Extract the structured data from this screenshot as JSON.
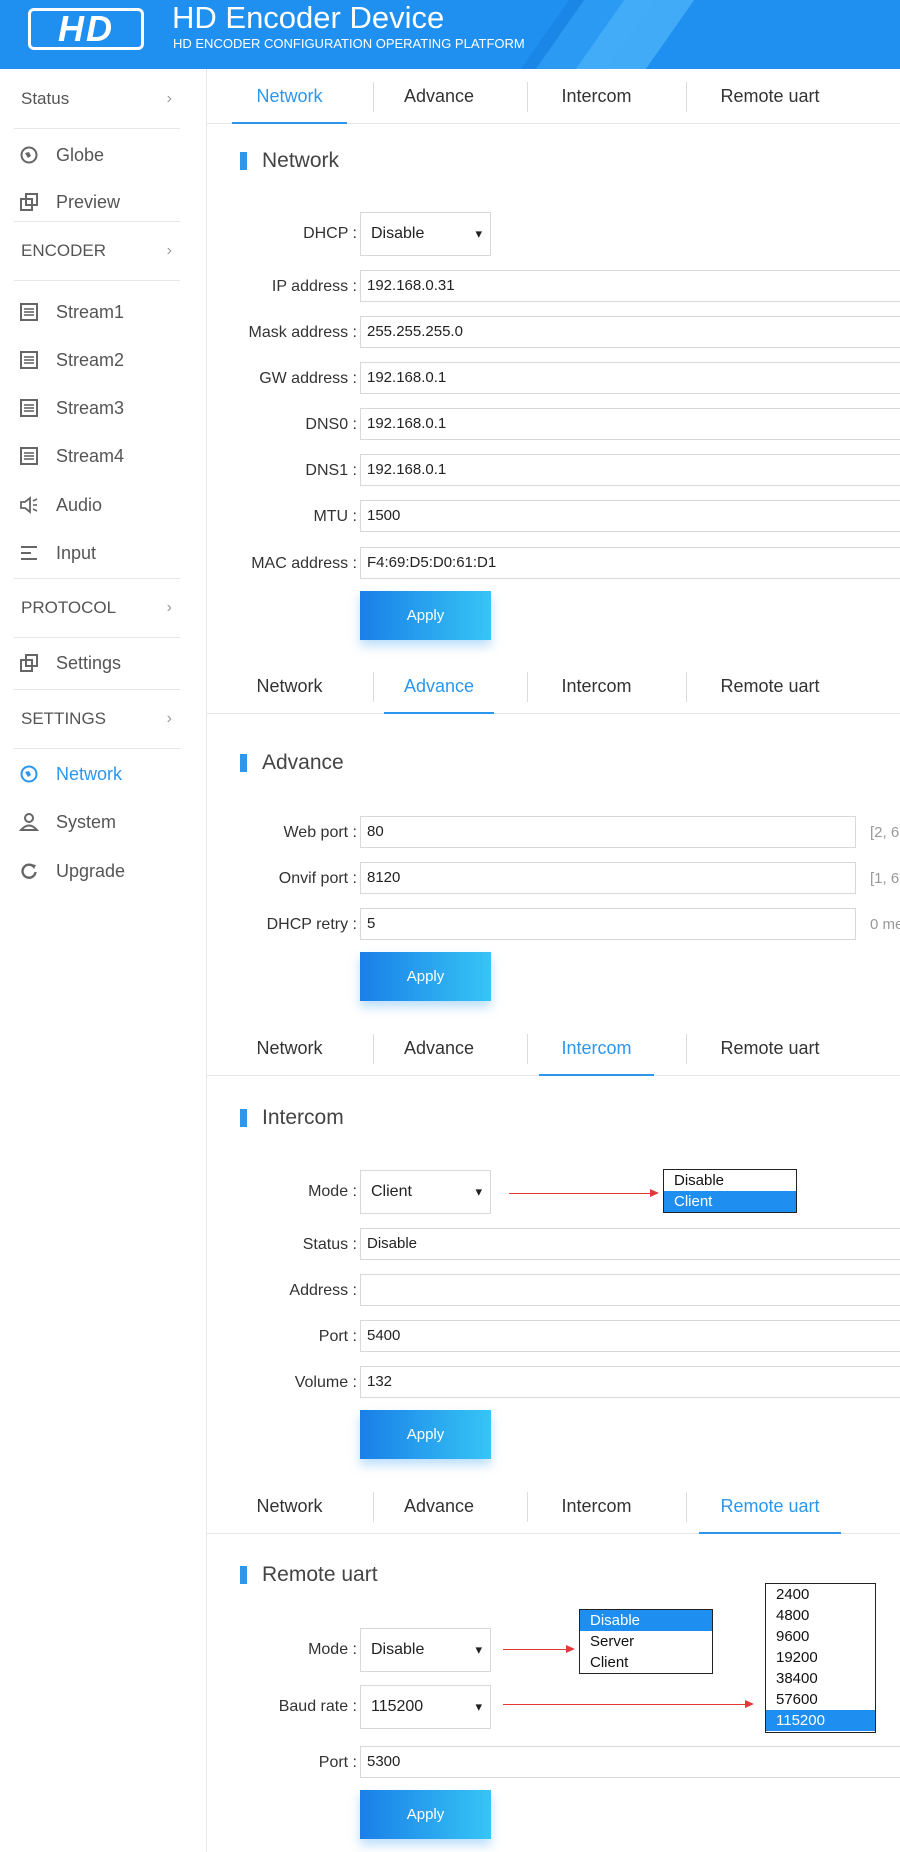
{
  "header": {
    "logo": "HD",
    "title": "HD Encoder Device",
    "subtitle": "HD ENCODER CONFIGURATION OPERATING PLATFORM"
  },
  "sidebar": {
    "groups": {
      "status": "Status",
      "encoder": "ENCODER",
      "protocol": "PROTOCOL",
      "settings": "SETTINGS"
    },
    "items": {
      "globe": "Globe",
      "preview": "Preview",
      "stream1": "Stream1",
      "stream2": "Stream2",
      "stream3": "Stream3",
      "stream4": "Stream4",
      "audio": "Audio",
      "input": "Input",
      "settings": "Settings",
      "network": "Network",
      "system": "System",
      "upgrade": "Upgrade"
    },
    "arrow": "›"
  },
  "tabs": [
    "Network",
    "Advance",
    "Intercom",
    "Remote uart"
  ],
  "network": {
    "title": "Network",
    "dhcp_label": "DHCP :",
    "dhcp_value": "Disable",
    "ip_label": "IP address :",
    "ip_value": "192.168.0.31",
    "mask_label": "Mask address :",
    "mask_value": "255.255.255.0",
    "gw_label": "GW address :",
    "gw_value": "192.168.0.1",
    "dns0_label": "DNS0 :",
    "dns0_value": "192.168.0.1",
    "dns1_label": "DNS1 :",
    "dns1_value": "192.168.0.1",
    "mtu_label": "MTU :",
    "mtu_value": "1500",
    "mac_label": "MAC address :",
    "mac_value": "F4:69:D5:D0:61:D1",
    "apply": "Apply"
  },
  "advance": {
    "title": "Advance",
    "webport_label": "Web port :",
    "webport_value": "80",
    "webport_hint": "[2, 6",
    "onvif_label": "Onvif port :",
    "onvif_value": "8120",
    "onvif_hint": "[1, 6",
    "retry_label": "DHCP retry :",
    "retry_value": "5",
    "retry_hint": "0 me",
    "apply": "Apply"
  },
  "intercom": {
    "title": "Intercom",
    "mode_label": "Mode :",
    "mode_value": "Client",
    "mode_options": [
      "Disable",
      "Client"
    ],
    "status_label": "Status :",
    "status_value": "Disable",
    "address_label": "Address :",
    "address_value": "",
    "port_label": "Port :",
    "port_value": "5400",
    "volume_label": "Volume :",
    "volume_value": "132",
    "apply": "Apply"
  },
  "remote_uart": {
    "title": "Remote uart",
    "mode_label": "Mode :",
    "mode_value": "Disable",
    "mode_options": [
      "Disable",
      "Server",
      "Client"
    ],
    "baud_label": "Baud rate :",
    "baud_value": "115200",
    "baud_options": [
      "2400",
      "4800",
      "9600",
      "19200",
      "38400",
      "57600",
      "115200"
    ],
    "port_label": "Port :",
    "port_value": "5300",
    "apply": "Apply"
  },
  "colors": {
    "accent": "#2b97ee",
    "header_bg": "#1f8ff0",
    "arrow_red": "#e23a3a"
  },
  "icons": {
    "dropdown": "▾"
  }
}
